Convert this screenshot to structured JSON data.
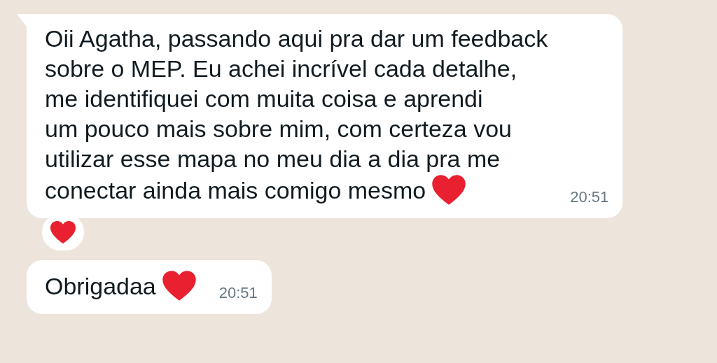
{
  "messages": [
    {
      "lines": [
        "Oii Agatha, passando aqui pra dar um feedback",
        "sobre o MEP. Eu achei incrível cada detalhe,",
        "me identifiquei com muita coisa e aprendi",
        "um pouco mais sobre mim, com certeza vou",
        "utilizar esse mapa no meu dia a dia pra me",
        "conectar ainda mais comigo mesmo"
      ],
      "time": "20:51",
      "tail": true,
      "reacted": true
    },
    {
      "lines": [
        "Obrigadaa"
      ],
      "time": "20:51",
      "tail": false,
      "reacted": false
    }
  ]
}
